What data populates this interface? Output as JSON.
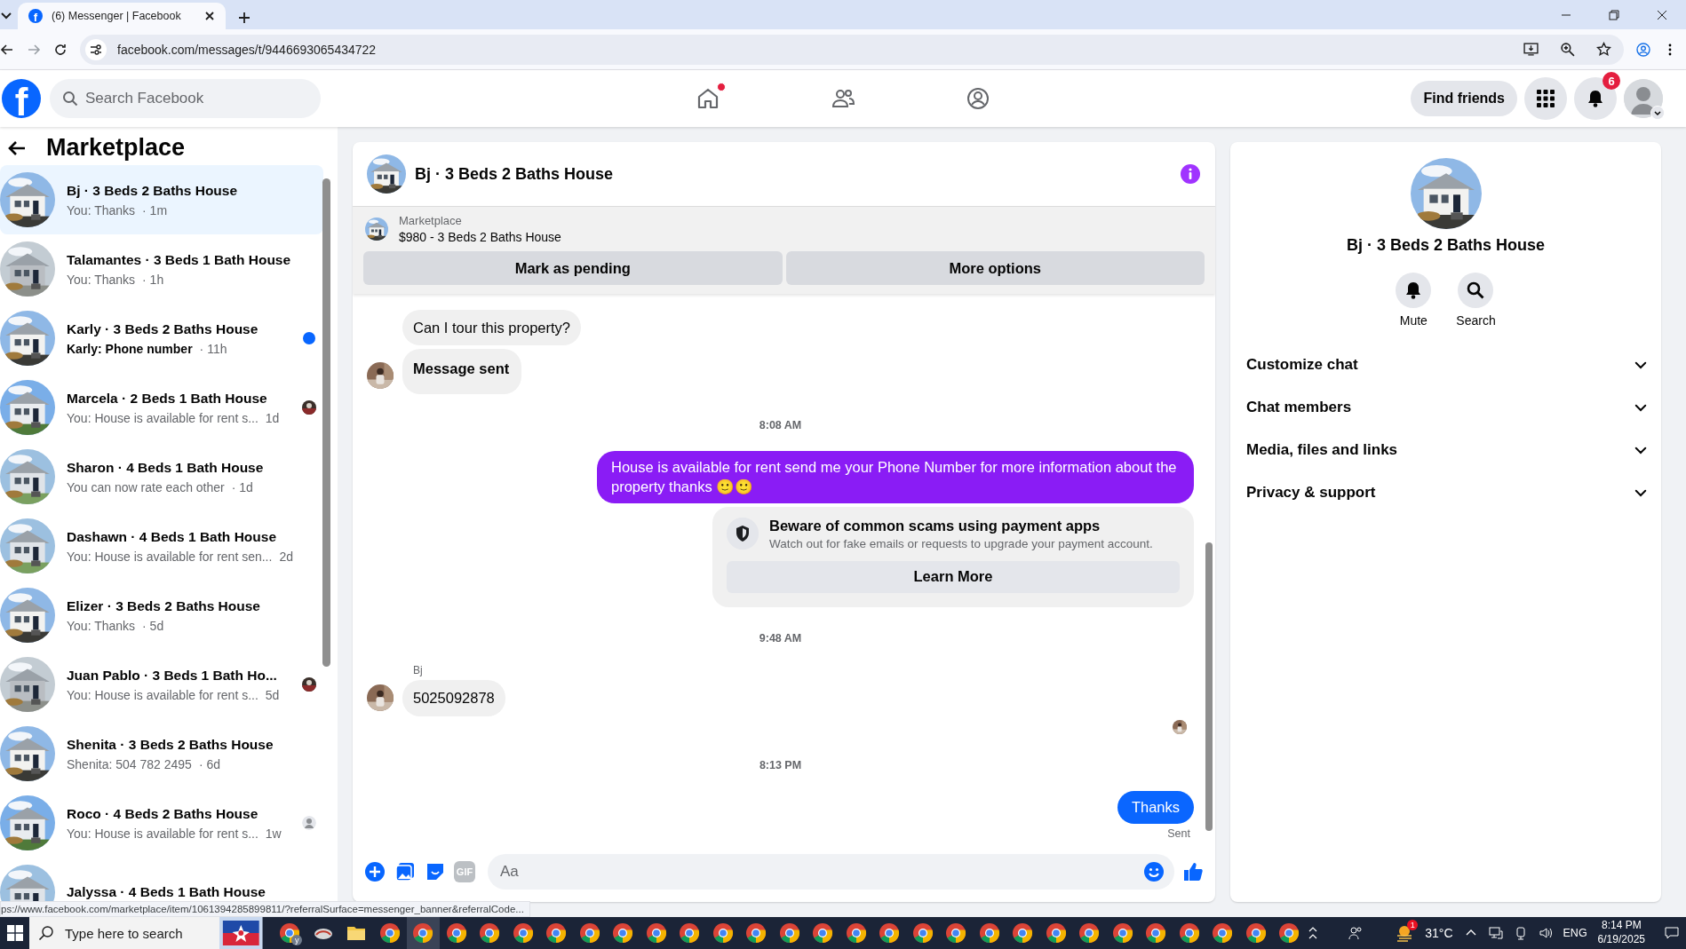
{
  "browser": {
    "tab": {
      "title": "(6) Messenger | Facebook",
      "icon_letter": "f",
      "selected": true
    },
    "url": "facebook.com/messages/t/9446693065434722"
  },
  "header": {
    "logo": "f",
    "search_placeholder": "Search Facebook",
    "nav": [
      {
        "kind": "home",
        "badge": true
      },
      {
        "kind": "friends",
        "badge": false
      },
      {
        "kind": "groups",
        "badge": false
      }
    ],
    "find_friends": "Find friends",
    "notifications": "6"
  },
  "sidebar": {
    "title": "Marketplace",
    "conversations": [
      {
        "title": "Bj · 3 Beds 2 Baths House",
        "preview": "You: Thanks",
        "time": "· 1m",
        "selected": true,
        "kind": "plain"
      },
      {
        "title": "Talamantes · 3 Beds 1 Bath House",
        "preview": "You: Thanks",
        "time": "· 1h",
        "selected": false,
        "kind": "plain"
      },
      {
        "title": "Karly · 3 Beds 2 Baths House",
        "preview": "Karly: Phone number",
        "time": "· 11h",
        "selected": false,
        "kind": "unread"
      },
      {
        "title": "Marcela · 2 Beds 1 Bath House",
        "preview": "You: House is available for rent s...",
        "time": "1d",
        "selected": false,
        "kind": "seen"
      },
      {
        "title": "Sharon · 4 Beds 1 Bath House",
        "preview": "You can now rate each other",
        "time": "· 1d",
        "selected": false,
        "kind": "plain"
      },
      {
        "title": "Dashawn · 4 Beds 1 Bath House",
        "preview": "You: House is available for rent sen...",
        "time": "2d",
        "selected": false,
        "kind": "plain"
      },
      {
        "title": "Elizer · 3 Beds 2 Baths House",
        "preview": "You: Thanks",
        "time": "· 5d",
        "selected": false,
        "kind": "plain"
      },
      {
        "title": "Juan Pablo · 3 Beds 1 Bath Ho...",
        "preview": "You: House is available for rent s...",
        "time": "5d",
        "selected": false,
        "kind": "seen"
      },
      {
        "title": "Shenita · 3 Beds 2 Baths House",
        "preview": "Shenita: 504 782 2495",
        "time": "· 6d",
        "selected": false,
        "kind": "plain"
      },
      {
        "title": "Roco · 4 Beds 2 Baths House",
        "preview": "You: House is available for rent s...",
        "time": "1w",
        "selected": false,
        "kind": "seen-default"
      },
      {
        "title": "Jalyssa · 4 Beds 1 Bath House",
        "selected": false,
        "kind": "plain"
      }
    ],
    "status_url": "ps://www.facebook.com/marketplace/item/1061394285899811/?referralSurface=messenger_banner&referralCode..."
  },
  "chat": {
    "title": "Bj · 3 Beds 2 Baths House",
    "listing": {
      "source": "Marketplace",
      "name": "$980 - 3 Beds 2 Baths House"
    },
    "actions": [
      "Mark as pending",
      "More options"
    ],
    "messages": [
      {
        "kind": "incoming",
        "text": "Can I tour this property?",
        "bold": false
      },
      {
        "kind": "incoming",
        "text": "Message sent",
        "bold": true
      },
      {
        "kind": "time",
        "text": "8:08 AM"
      },
      {
        "kind": "outgoing",
        "text": "House is available for rent send me your Phone Number for more information about the property thanks 🙂🙂",
        "color": "#8a1cf5"
      },
      {
        "kind": "notice",
        "title": "Beware of common scams using payment apps",
        "text": "Watch out for fake emails or requests to upgrade your payment account.",
        "button": "Learn More"
      },
      {
        "kind": "time",
        "text": "9:48 AM"
      },
      {
        "kind": "incoming",
        "sender": "Bj",
        "text": "5025092878",
        "bold": false
      },
      {
        "kind": "seen"
      },
      {
        "kind": "time",
        "text": "8:13 PM"
      },
      {
        "kind": "outgoing",
        "text": "Thanks",
        "color": "#0a66ff",
        "status": "Sent"
      }
    ],
    "composer": {
      "gif_label": "GIF",
      "placeholder": "Aa"
    }
  },
  "details": {
    "title": "Bj · 3 Beds 2 Baths House",
    "actions": [
      {
        "kind": "mute",
        "label": "Mute"
      },
      {
        "kind": "search",
        "label": "Search"
      }
    ],
    "sections": [
      {
        "label": "Customize chat",
        "expanded": false
      },
      {
        "label": "Chat members",
        "expanded": false
      },
      {
        "label": "Media, files and links",
        "expanded": false
      },
      {
        "label": "Privacy & support",
        "expanded": false
      }
    ]
  },
  "taskbar": {
    "search_placeholder": "Type here to search",
    "apps": [
      {
        "kind": "chrome",
        "badge": "y",
        "selected": false
      },
      {
        "kind": "sled",
        "selected": false
      },
      {
        "kind": "folder",
        "selected": false
      },
      {
        "kind": "chrome",
        "selected": false
      },
      {
        "kind": "chrome",
        "selected": true
      },
      {
        "kind": "chrome",
        "selected": false
      },
      {
        "kind": "chrome",
        "selected": false
      },
      {
        "kind": "chrome",
        "selected": false
      },
      {
        "kind": "chrome",
        "selected": false
      },
      {
        "kind": "chrome",
        "selected": false
      },
      {
        "kind": "chrome",
        "selected": false
      },
      {
        "kind": "chrome",
        "selected": false
      },
      {
        "kind": "chrome",
        "selected": false
      },
      {
        "kind": "chrome",
        "selected": false
      },
      {
        "kind": "chrome",
        "selected": false
      },
      {
        "kind": "chrome",
        "selected": false
      },
      {
        "kind": "chrome",
        "selected": false
      },
      {
        "kind": "chrome",
        "selected": false
      },
      {
        "kind": "chrome",
        "selected": false
      },
      {
        "kind": "chrome",
        "selected": false
      },
      {
        "kind": "chrome",
        "selected": false
      },
      {
        "kind": "chrome",
        "selected": false
      },
      {
        "kind": "chrome",
        "selected": false
      },
      {
        "kind": "chrome",
        "selected": false
      },
      {
        "kind": "chrome",
        "selected": false
      },
      {
        "kind": "chrome",
        "selected": false
      },
      {
        "kind": "chrome",
        "selected": false
      },
      {
        "kind": "chrome",
        "selected": false
      },
      {
        "kind": "chrome",
        "selected": false
      },
      {
        "kind": "chrome",
        "selected": false
      },
      {
        "kind": "chrome",
        "selected": false
      }
    ],
    "weather_badge": "1",
    "temperature": "31°C",
    "language": "ENG",
    "time": "8:14 PM",
    "date": "6/19/2025"
  }
}
